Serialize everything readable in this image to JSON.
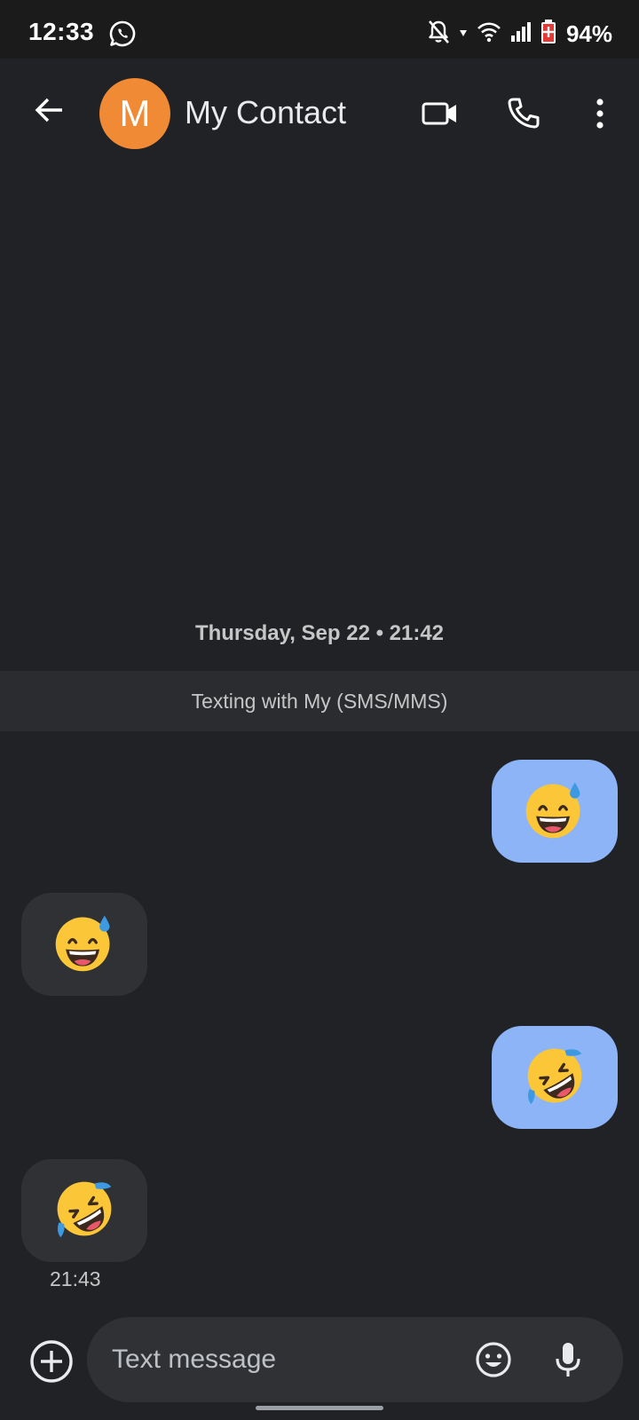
{
  "status_bar": {
    "time": "12:33",
    "battery": "94%",
    "icons": [
      "whatsapp-icon",
      "bell-off-icon",
      "wifi-icon",
      "signal-icon",
      "battery-saver-icon"
    ]
  },
  "header": {
    "avatar_letter": "M",
    "contact_name": "My Contact",
    "avatar_color": "#f08a35",
    "icons": [
      "back-arrow-icon",
      "video-call-icon",
      "phone-icon",
      "more-vert-icon"
    ]
  },
  "conversation": {
    "date_line": "Thursday, Sep 22 • 21:42",
    "texting_banner": "Texting with My (SMS/MMS)",
    "messages": [
      {
        "direction": "outgoing",
        "emoji": "grinning-face-with-sweat"
      },
      {
        "direction": "incoming",
        "emoji": "grinning-face-with-sweat"
      },
      {
        "direction": "outgoing",
        "emoji": "rolling-on-the-floor-laughing"
      },
      {
        "direction": "incoming",
        "emoji": "rolling-on-the-floor-laughing"
      }
    ],
    "last_time": "21:43"
  },
  "compose": {
    "placeholder": "Text message",
    "icons": [
      "add-icon",
      "emoji-icon",
      "mic-icon"
    ]
  },
  "colors": {
    "background": "#212226",
    "outgoing_bubble": "#8cb4f6",
    "incoming_bubble": "#303134"
  }
}
